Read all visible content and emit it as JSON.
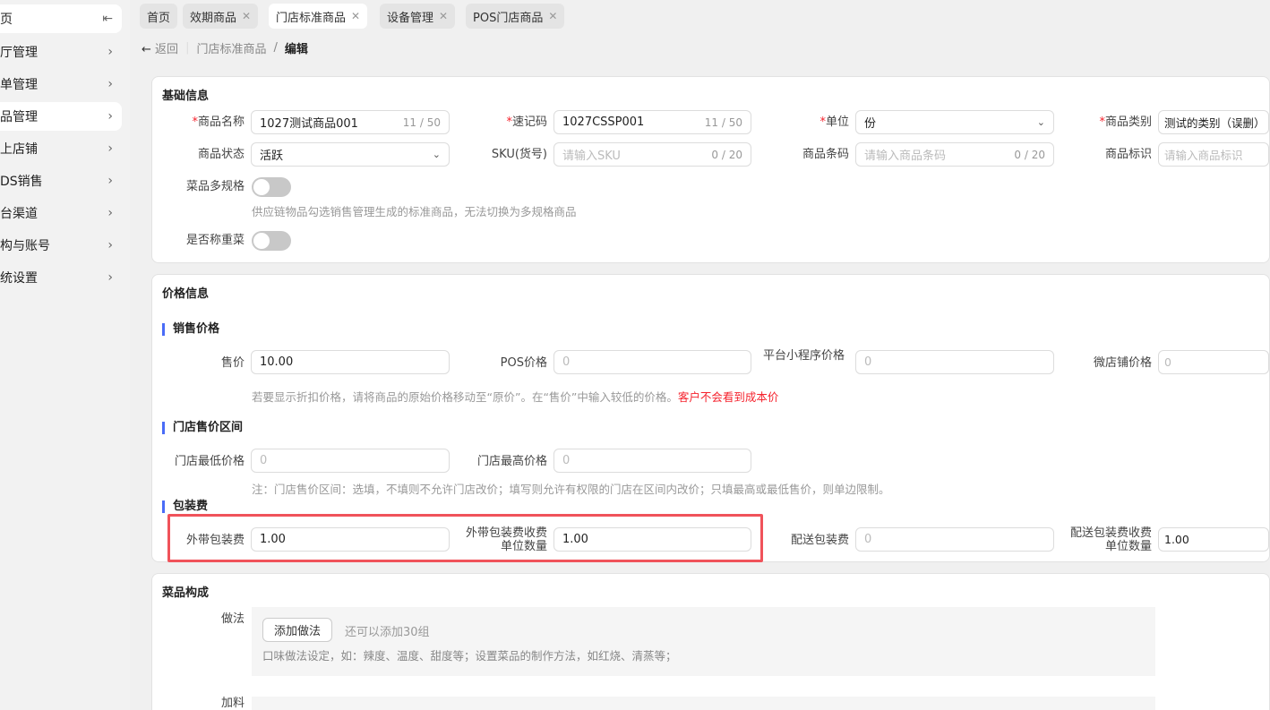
{
  "sidebar": {
    "top_label": "页",
    "items": [
      {
        "label": "厅管理"
      },
      {
        "label": "单管理"
      },
      {
        "label": "品管理"
      },
      {
        "label": "上店铺"
      },
      {
        "label": "DS销售"
      },
      {
        "label": "台渠道"
      },
      {
        "label": "构与账号"
      },
      {
        "label": "统设置"
      }
    ]
  },
  "tabs": [
    {
      "label": "首页"
    },
    {
      "label": "效期商品"
    },
    {
      "label": "门店标准商品"
    },
    {
      "label": "设备管理"
    },
    {
      "label": "POS门店商品"
    }
  ],
  "breadcrumb": {
    "back": "返回",
    "parent": "门店标准商品",
    "sep": "/",
    "current": "编辑"
  },
  "basic": {
    "title": "基础信息",
    "name": {
      "label": "商品名称",
      "value": "1027测试商品001",
      "count": "11 / 50"
    },
    "code": {
      "label": "速记码",
      "value": "1027CSSP001",
      "count": "11 / 50"
    },
    "unit": {
      "label": "单位",
      "value": "份"
    },
    "category": {
      "label": "商品类别",
      "value": "测试的类别（误删）"
    },
    "status": {
      "label": "商品状态",
      "value": "活跃"
    },
    "sku": {
      "label": "SKU(货号)",
      "placeholder": "请输入SKU",
      "count": "0 / 20"
    },
    "barcode": {
      "label": "商品条码",
      "placeholder": "请输入商品条码",
      "count": "0 / 20"
    },
    "mark": {
      "label": "商品标识",
      "placeholder": "请输入商品标识"
    },
    "multispec": {
      "label": "菜品多规格",
      "on": false,
      "hint": "供应链物品勾选销售管理生成的标准商品，无法切换为多规格商品"
    },
    "weigh": {
      "label": "是否称重菜",
      "on": false
    }
  },
  "price": {
    "title": "价格信息",
    "sale_title": "销售价格",
    "sale": {
      "label": "售价",
      "value": "10.00"
    },
    "pos": {
      "label": "POS价格",
      "placeholder": "0"
    },
    "mini": {
      "label": "平台小程序价格",
      "placeholder": "0"
    },
    "wx": {
      "label": "微店铺价格",
      "placeholder": "0"
    },
    "sale_hint": "若要显示折扣价格，请将商品的原始价格移动至“原价”。在“售价”中输入较低的价格。",
    "sale_hint_red": "客户不会看到成本价",
    "range_title": "门店售价区间",
    "min": {
      "label": "门店最低价格",
      "placeholder": "0"
    },
    "max": {
      "label": "门店最高价格",
      "placeholder": "0"
    },
    "range_hint": "注：门店售价区间：选填，不填则不允许门店改价；填写则允许有权限的门店在区间内改价；只填最高或最低售价，则单边限制。",
    "pack_title": "包装费",
    "takeout": {
      "label": "外带包装费",
      "value": "1.00"
    },
    "takeout_unit": {
      "label": "外带包装费收费单位数量",
      "value": "1.00"
    },
    "delivery": {
      "label": "配送包装费",
      "placeholder": "0"
    },
    "delivery_unit": {
      "label": "配送包装费收费单位数量",
      "value": "1.00"
    }
  },
  "compose": {
    "title": "菜品构成",
    "method_label": "做法",
    "add_method": "添加做法",
    "remain": "还可以添加30组",
    "method_hint": "口味做法设定，如：辣度、温度、甜度等；设置菜品的制作方法，如红烧、清蒸等；",
    "topping_label": "加料"
  }
}
